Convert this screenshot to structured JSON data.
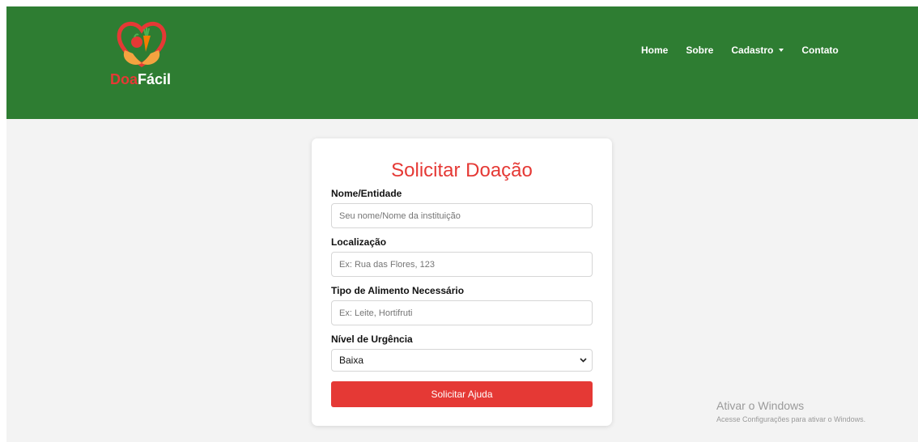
{
  "brand": {
    "logo_icon": "heart-hands-vegetables-logo",
    "name_part1": "Doa",
    "name_part2": "Fácil"
  },
  "nav": {
    "items": [
      {
        "label": "Home"
      },
      {
        "label": "Sobre"
      },
      {
        "label": "Cadastro",
        "has_dropdown": true
      },
      {
        "label": "Contato"
      }
    ]
  },
  "form": {
    "title": "Solicitar Doação",
    "fields": [
      {
        "label": "Nome/Entidade",
        "placeholder": "Seu nome/Nome da instituição",
        "value": ""
      },
      {
        "label": "Localização",
        "placeholder": "Ex: Rua das Flores, 123",
        "value": ""
      },
      {
        "label": "Tipo de Alimento Necessário",
        "placeholder": "Ex: Leite, Hortifruti",
        "value": ""
      }
    ],
    "urgency": {
      "label": "Nível de Urgência",
      "selected": "Baixa"
    },
    "submit_label": "Solicitar Ajuda"
  },
  "watermark": {
    "title": "Ativar o Windows",
    "subtitle": "Acesse Configurações para ativar o Windows."
  },
  "colors": {
    "navbar": "#2e7d32",
    "accent": "#e53935",
    "page_background": "#f3f3f3"
  }
}
